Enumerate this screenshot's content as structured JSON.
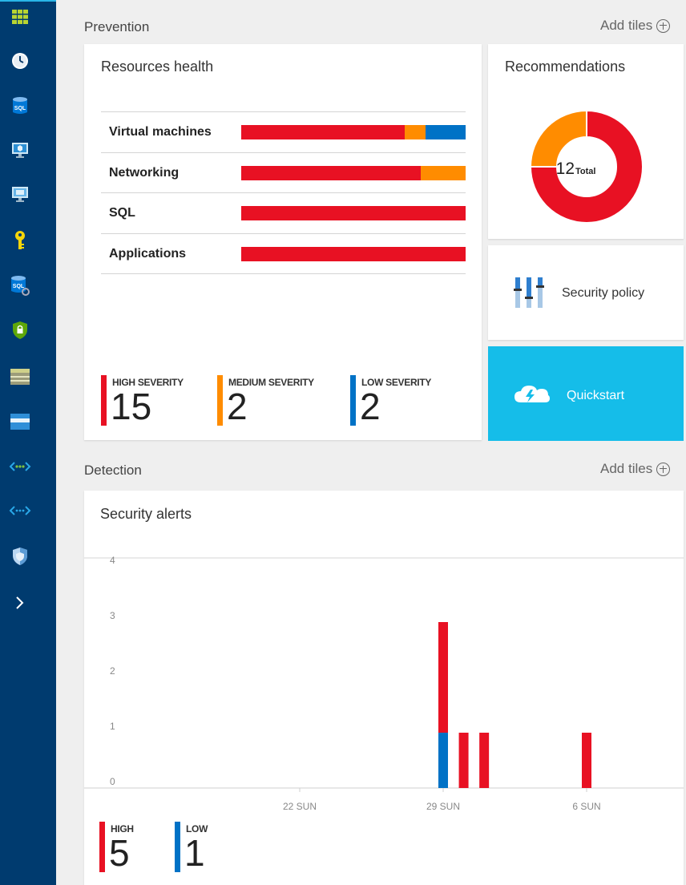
{
  "sidebar": {
    "items": [
      {
        "icon": "dashboard-grid-icon"
      },
      {
        "icon": "clock-icon"
      },
      {
        "icon": "sql-database-icon",
        "text": "SQL"
      },
      {
        "icon": "virtual-machine-icon"
      },
      {
        "icon": "virtual-machine-classic-icon"
      },
      {
        "icon": "key-icon"
      },
      {
        "icon": "sql-server-icon",
        "text": "SQL"
      },
      {
        "icon": "security-lock-shield-icon"
      },
      {
        "icon": "storage-icon"
      },
      {
        "icon": "card-icon"
      },
      {
        "icon": "virtual-network-icon"
      },
      {
        "icon": "virtual-network-classic-icon"
      },
      {
        "icon": "security-center-shield-icon"
      },
      {
        "icon": "expand-chevron-icon"
      }
    ]
  },
  "prevention": {
    "title": "Prevention",
    "add_tiles": "Add tiles"
  },
  "detection": {
    "title": "Detection",
    "add_tiles": "Add tiles"
  },
  "resources_health": {
    "title": "Resources health",
    "rows": [
      {
        "label": "Virtual machines",
        "segments": [
          {
            "color": "#e81123",
            "fraction": 0.73
          },
          {
            "color": "#ff8c00",
            "fraction": 0.09
          },
          {
            "color": "#0072c6",
            "fraction": 0.18
          }
        ]
      },
      {
        "label": "Networking",
        "segments": [
          {
            "color": "#e81123",
            "fraction": 0.8
          },
          {
            "color": "#ff8c00",
            "fraction": 0.2
          }
        ]
      },
      {
        "label": "SQL",
        "segments": [
          {
            "color": "#e81123",
            "fraction": 1.0
          }
        ]
      },
      {
        "label": "Applications",
        "segments": [
          {
            "color": "#e81123",
            "fraction": 1.0
          }
        ]
      }
    ],
    "severities": [
      {
        "label": "HIGH SEVERITY",
        "count": "15",
        "color": "#e81123"
      },
      {
        "label": "MEDIUM SEVERITY",
        "count": "2",
        "color": "#ff8c00"
      },
      {
        "label": "LOW SEVERITY",
        "count": "2",
        "color": "#0072c6"
      }
    ]
  },
  "recommendations": {
    "title": "Recommendations",
    "total": "12",
    "total_label": "Total",
    "donut": [
      {
        "color": "#e81123",
        "value": 9
      },
      {
        "color": "#ff8c00",
        "value": 3
      }
    ]
  },
  "security_policy": {
    "label": "Security policy",
    "icon": "policy-sliders-icon"
  },
  "quickstart": {
    "label": "Quickstart",
    "icon": "cloud-lightning-icon"
  },
  "security_alerts": {
    "title": "Security alerts",
    "legend": [
      {
        "label": "HIGH",
        "count": "5",
        "color": "#e81123"
      },
      {
        "label": "LOW",
        "count": "1",
        "color": "#0072c6"
      }
    ]
  },
  "colors": {
    "high": "#e81123",
    "medium": "#ff8c00",
    "low": "#0072c6",
    "accent": "#15bde9",
    "sidebar": "#003b6f"
  },
  "chart_data": {
    "type": "bar",
    "stacked": true,
    "x_ticks": [
      "22 SUN",
      "29 SUN",
      "6 SUN"
    ],
    "ylim": [
      0,
      4
    ],
    "y_ticks": [
      "0",
      "1",
      "2",
      "3",
      "4"
    ],
    "bars": [
      {
        "x": "29 SUN",
        "offset_days": 0,
        "high": 2,
        "low": 1
      },
      {
        "x": "30",
        "offset_days": 1,
        "high": 1,
        "low": 0
      },
      {
        "x": "31",
        "offset_days": 2,
        "high": 1,
        "low": 0
      },
      {
        "x": "6 SUN",
        "offset_days": 7,
        "high": 1,
        "low": 0
      }
    ],
    "series": [
      {
        "name": "HIGH",
        "color": "#e81123"
      },
      {
        "name": "LOW",
        "color": "#0072c6"
      }
    ]
  }
}
